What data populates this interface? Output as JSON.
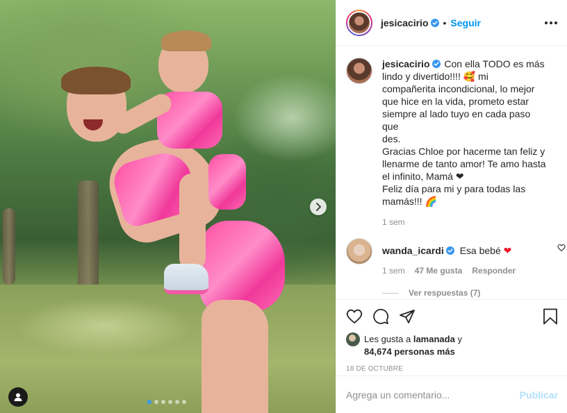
{
  "post": {
    "author": "jesicacirio",
    "follow_label": "Seguir",
    "separator": "•"
  },
  "caption": {
    "username": "jesicacirio",
    "lines": [
      "Con ella TODO es más",
      "lindo y divertido!!!! 🥰 mi",
      "compañerita incondicional, lo mejor",
      "que hice en la vida, prometo estar",
      "siempre al lado tuyo en cada paso que",
      "des.",
      "Gracias Chloe por hacerme tan feliz y",
      "llenarme de tanto amor! Te amo hasta",
      "el infinito, Mamá ❤",
      "Feliz día para mi y para todas las",
      "mamás!!! 🌈"
    ],
    "time": "1 sem"
  },
  "comment": {
    "username": "wanda_icardi",
    "text": "Esa bebé",
    "heart": "❤",
    "time": "1 sem",
    "likes": "47 Me gusta",
    "reply_label": "Responder",
    "view_replies": "Ver respuestas (7)"
  },
  "likes": {
    "prefix": "Les gusta a",
    "user": "lamanada",
    "conj": "y",
    "count_text": "84,674 personas más"
  },
  "date": "18 DE OCTUBRE",
  "add_comment": {
    "placeholder": "Agrega un comentario...",
    "publish_label": "Publicar"
  },
  "carousel": {
    "total": 6,
    "active_index": 0
  },
  "colors": {
    "link_blue": "#0095f6",
    "verified_blue": "#3897f0",
    "publish_disabled": "#b2dffc",
    "outfit_pink": "#ff4fa3"
  }
}
